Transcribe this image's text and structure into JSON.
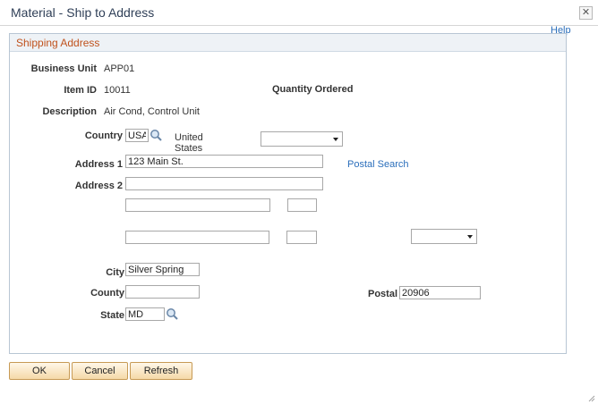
{
  "window": {
    "title": "Material - Ship to Address",
    "close_glyph": "✕",
    "help_label": "Help"
  },
  "group": {
    "title": "Shipping Address"
  },
  "fields": {
    "business_unit": {
      "label": "Business Unit",
      "value": "APP01"
    },
    "item_id": {
      "label": "Item ID",
      "value": "10011"
    },
    "quantity_ordered": {
      "label": "Quantity Ordered"
    },
    "description": {
      "label": "Description",
      "value": "Air Cond, Control Unit"
    },
    "country": {
      "label": "Country",
      "value": "USA",
      "description_line1": "United",
      "description_line2": "States"
    },
    "address1": {
      "label": "Address 1",
      "value": "123 Main St."
    },
    "address2": {
      "label": "Address 2",
      "value": ""
    },
    "postal_search": {
      "label": "Postal Search"
    },
    "city": {
      "label": "City",
      "value": "Silver Spring"
    },
    "county": {
      "label": "County",
      "value": ""
    },
    "postal": {
      "label": "Postal",
      "value": "20906"
    },
    "state": {
      "label": "State",
      "value": "MD"
    }
  },
  "buttons": {
    "ok": "OK",
    "cancel": "Cancel",
    "refresh": "Refresh"
  },
  "icons": {
    "lookup": "magnifier-icon",
    "dropdown": "chevron-down-icon"
  },
  "colors": {
    "group_title": "#c0521d",
    "link": "#2a6ebb",
    "window_title": "#2f3f57"
  }
}
